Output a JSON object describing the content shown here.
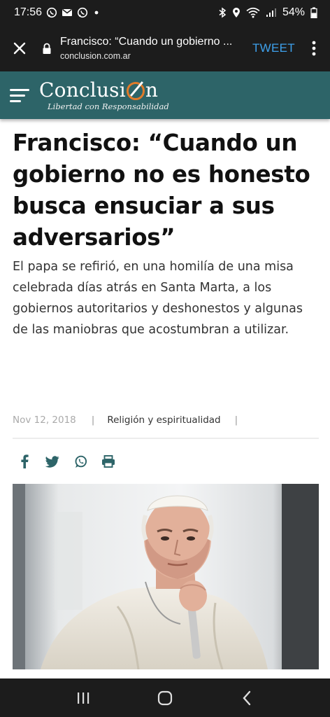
{
  "status_bar": {
    "time": "17:56",
    "battery": "54%",
    "icons": [
      "whatsapp-icon",
      "gmail-icon",
      "whatsapp-icon",
      "dot-icon",
      "bluetooth-icon",
      "location-icon",
      "wifi-icon",
      "signal-icon",
      "battery-icon"
    ]
  },
  "browser": {
    "page_title": "Francisco: “Cuando un gobierno ...",
    "url": "conclusion.com.ar",
    "tweet_label": "TWEET"
  },
  "site": {
    "logo_name_pre": "Conclusi",
    "logo_name_post": "n",
    "tagline": "Libertad con Responsabilidad",
    "colors": {
      "header": "#2d6468",
      "accent": "#e07b2a"
    }
  },
  "article": {
    "headline": "Francisco: “Cuando un gobierno no es honesto busca ensuciar a sus adversarios”",
    "lead": "El papa se refirió, en una homilía de una misa celebrada días atrás en Santa Marta, a los gobiernos autoritarios y deshonestos y algunas de las maniobras que acostumbran a utilizar.",
    "date": "Nov 12, 2018",
    "separator": "|",
    "category": "Religión y espiritualidad"
  },
  "share_icons": [
    "facebook-icon",
    "twitter-icon",
    "whatsapp-icon",
    "print-icon"
  ]
}
